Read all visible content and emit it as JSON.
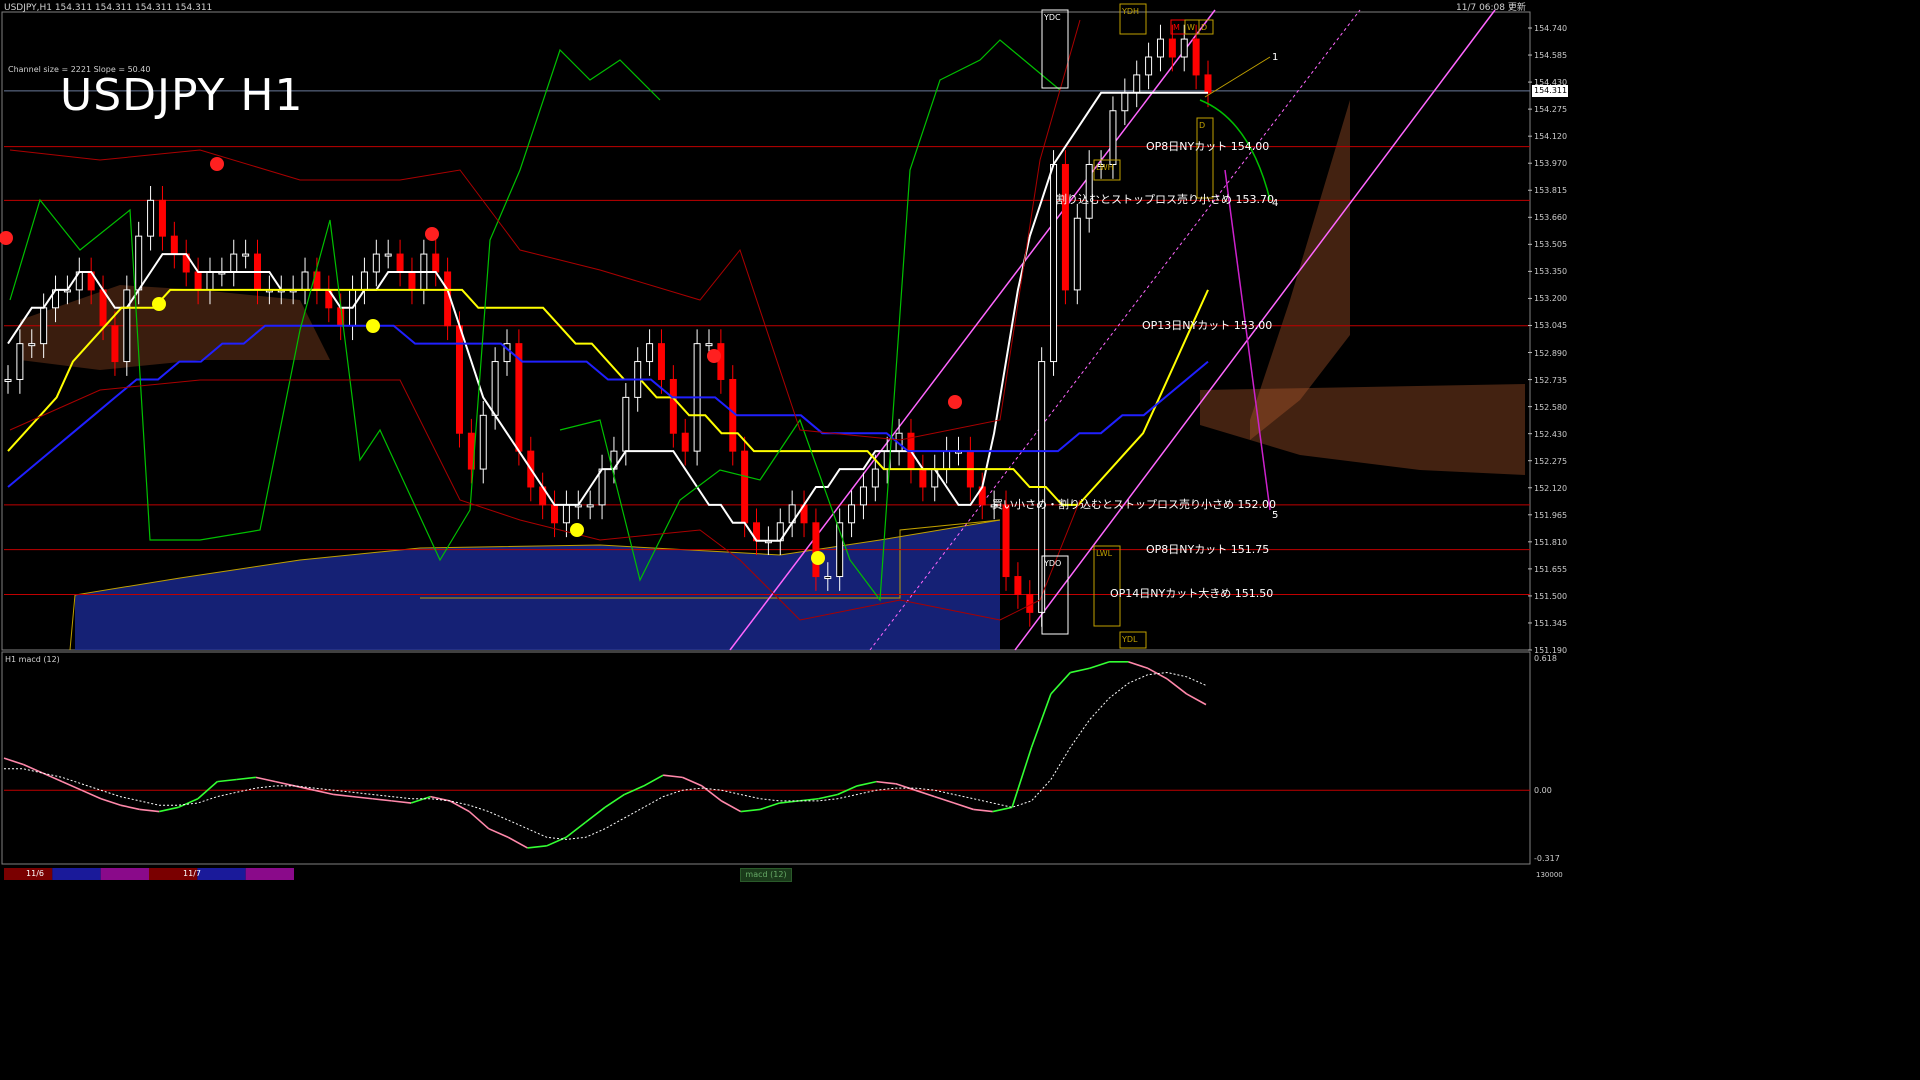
{
  "header": {
    "symbol_info": "USDJPY,H1  154.311 154.311 154.311 154.311",
    "datetime": "11/7 06:08 更新",
    "channel_info": "Channel size = 2221 Slope = 50.40",
    "big_title": "USDJPY H1"
  },
  "chart_data": [
    {
      "type": "line",
      "title": "USDJPY H1",
      "ylim": [
        151.19,
        154.74
      ],
      "yticks": [
        "154.740",
        "154.585",
        "154.430",
        "154.275",
        "154.120",
        "153.970",
        "153.815",
        "153.660",
        "153.505",
        "153.350",
        "153.200",
        "153.045",
        "152.890",
        "152.735",
        "152.580",
        "152.430",
        "152.275",
        "152.120",
        "151.965",
        "151.810",
        "151.655",
        "151.500",
        "151.345",
        "151.190"
      ],
      "current_price": "154.311",
      "price_levels": [
        {
          "price": 154.0,
          "label": "OP8日NYカット 154.00"
        },
        {
          "price": 153.7,
          "label": "割り込むとストップロス売り小さめ 153.70"
        },
        {
          "price": 153.0,
          "label": "OP13日NYカット 153.00"
        },
        {
          "price": 152.0,
          "label": "買い小さめ・割り込むとストップロス売り小さめ 152.00"
        },
        {
          "price": 151.75,
          "label": "OP8日NYカット 151.75"
        },
        {
          "price": 151.5,
          "label": "OP14日NYカット大きめ 151.50"
        }
      ],
      "annotations": [
        "YDC",
        "YDO",
        "YDH",
        "YDL",
        "LWH",
        "LWL",
        "D",
        "W",
        "M",
        "1",
        "4",
        "5"
      ],
      "series": [
        {
          "name": "close",
          "values": [
            152.7,
            152.9,
            152.9,
            153.1,
            153.2,
            153.2,
            153.3,
            153.2,
            153.0,
            152.8,
            153.2,
            153.5,
            153.7,
            153.5,
            153.4,
            153.3,
            153.2,
            153.3,
            153.3,
            153.4,
            153.4,
            153.2,
            153.2,
            153.2,
            153.2,
            153.3,
            153.2,
            153.1,
            153.0,
            153.2,
            153.3,
            153.4,
            153.4,
            153.3,
            153.2,
            153.4,
            153.3,
            153.0,
            152.4,
            152.2,
            152.5,
            152.8,
            152.9,
            152.3,
            152.1,
            152.0,
            151.9,
            152.0,
            152.0,
            152.0,
            152.2,
            152.3,
            152.6,
            152.8,
            152.9,
            152.7,
            152.4,
            152.3,
            152.9,
            152.9,
            152.7,
            152.3,
            151.9,
            151.8,
            151.8,
            151.9,
            152.0,
            151.9,
            151.6,
            151.6,
            151.9,
            152.0,
            152.1,
            152.2,
            152.3,
            152.4,
            152.2,
            152.1,
            152.2,
            152.3,
            152.3,
            152.1,
            152.0,
            152.0,
            151.6,
            151.5,
            151.4,
            152.8,
            153.9,
            153.2,
            153.6,
            153.9,
            153.9,
            154.2,
            154.3,
            154.4,
            154.5,
            154.6,
            154.5,
            154.6,
            154.4,
            154.3
          ]
        },
        {
          "name": "ma-short",
          "values": [
            152.9,
            153.0,
            153.1,
            153.1,
            153.2,
            153.2,
            153.3,
            153.3,
            153.2,
            153.1,
            153.1,
            153.2,
            153.3,
            153.4,
            153.4,
            153.4,
            153.3,
            153.3,
            153.3,
            153.3,
            153.3,
            153.3,
            153.3,
            153.2,
            153.2,
            153.2,
            153.2,
            153.2,
            153.1,
            153.1,
            153.2,
            153.2,
            153.3,
            153.3,
            153.3,
            153.3,
            153.3,
            153.2,
            153.0,
            152.8,
            152.6,
            152.5,
            152.4,
            152.3,
            152.2,
            152.1,
            152.0,
            152.0,
            152.0,
            152.1,
            152.2,
            152.2,
            152.3,
            152.3,
            152.3,
            152.3,
            152.3,
            152.2,
            152.1,
            152.0,
            152.0,
            151.9,
            151.9,
            151.8,
            151.8,
            151.8,
            151.9,
            152.0,
            152.1,
            152.1,
            152.2,
            152.2,
            152.2,
            152.3,
            152.3,
            152.3,
            152.3,
            152.2,
            152.2,
            152.1,
            152.0,
            152.0,
            152.1,
            152.4,
            152.8,
            153.2,
            153.5,
            153.7,
            153.9,
            154.0,
            154.1,
            154.2,
            154.3,
            154.3,
            154.3,
            154.3,
            154.3,
            154.3,
            154.3,
            154.3,
            154.3,
            154.3
          ]
        },
        {
          "name": "ma-mid",
          "values": [
            152.3,
            152.4,
            152.5,
            152.6,
            152.8,
            152.9,
            153.0,
            153.1,
            153.1,
            153.1,
            153.2,
            153.2,
            153.2,
            153.2,
            153.2,
            153.2,
            153.2,
            153.2,
            153.2,
            153.2,
            153.2,
            153.2,
            153.2,
            153.2,
            153.2,
            153.2,
            153.2,
            153.2,
            153.2,
            153.1,
            153.1,
            153.1,
            153.1,
            153.1,
            153.0,
            152.9,
            152.9,
            152.8,
            152.7,
            152.7,
            152.6,
            152.6,
            152.5,
            152.5,
            152.4,
            152.4,
            152.3,
            152.3,
            152.3,
            152.3,
            152.3,
            152.3,
            152.3,
            152.3,
            152.2,
            152.2,
            152.2,
            152.2,
            152.2,
            152.2,
            152.2,
            152.2,
            152.2,
            152.1,
            152.1,
            152.0,
            152.0,
            152.1,
            152.2,
            152.3,
            152.4,
            152.6,
            152.8,
            153.0,
            153.2
          ]
        },
        {
          "name": "ma-long",
          "values": [
            152.1,
            152.2,
            152.3,
            152.4,
            152.5,
            152.6,
            152.7,
            152.7,
            152.8,
            152.8,
            152.9,
            152.9,
            153.0,
            153.0,
            153.0,
            153.0,
            153.0,
            153.0,
            153.0,
            152.9,
            152.9,
            152.9,
            152.9,
            152.9,
            152.8,
            152.8,
            152.8,
            152.8,
            152.7,
            152.7,
            152.7,
            152.6,
            152.6,
            152.6,
            152.5,
            152.5,
            152.5,
            152.5,
            152.4,
            152.4,
            152.4,
            152.4,
            152.3,
            152.3,
            152.3,
            152.3,
            152.3,
            152.3,
            152.3,
            152.3,
            152.4,
            152.4,
            152.5,
            152.5,
            152.6,
            152.7,
            152.8
          ]
        }
      ]
    },
    {
      "type": "line",
      "title": "H1  macd (12)",
      "ylim": [
        -0.317,
        0.618
      ],
      "yticks": [
        "0.618",
        "0.00",
        "-0.317"
      ],
      "series": [
        {
          "name": "macd",
          "values": [
            0.15,
            0.12,
            0.08,
            0.04,
            0.0,
            -0.04,
            -0.07,
            -0.09,
            -0.1,
            -0.08,
            -0.04,
            0.04,
            0.05,
            0.06,
            0.04,
            0.02,
            0.0,
            -0.02,
            -0.03,
            -0.04,
            -0.05,
            -0.06,
            -0.03,
            -0.05,
            -0.1,
            -0.18,
            -0.22,
            -0.27,
            -0.26,
            -0.22,
            -0.15,
            -0.08,
            -0.02,
            0.02,
            0.07,
            0.06,
            0.02,
            -0.05,
            -0.1,
            -0.09,
            -0.06,
            -0.05,
            -0.04,
            -0.02,
            0.02,
            0.04,
            0.03,
            0.0,
            -0.03,
            -0.06,
            -0.09,
            -0.1,
            -0.08,
            0.2,
            0.45,
            0.55,
            0.57,
            0.6,
            0.6,
            0.57,
            0.52,
            0.45,
            0.4
          ]
        },
        {
          "name": "signal",
          "values": [
            0.1,
            0.1,
            0.08,
            0.06,
            0.03,
            0.0,
            -0.03,
            -0.05,
            -0.07,
            -0.07,
            -0.06,
            -0.03,
            -0.01,
            0.01,
            0.02,
            0.02,
            0.01,
            0.0,
            -0.01,
            -0.02,
            -0.03,
            -0.04,
            -0.04,
            -0.05,
            -0.07,
            -0.1,
            -0.14,
            -0.18,
            -0.22,
            -0.23,
            -0.22,
            -0.18,
            -0.13,
            -0.08,
            -0.03,
            0.0,
            0.01,
            0.0,
            -0.02,
            -0.04,
            -0.05,
            -0.05,
            -0.05,
            -0.04,
            -0.02,
            0.0,
            0.01,
            0.01,
            0.0,
            -0.02,
            -0.04,
            -0.06,
            -0.08,
            -0.05,
            0.05,
            0.2,
            0.33,
            0.43,
            0.5,
            0.54,
            0.55,
            0.53,
            0.49
          ]
        }
      ]
    }
  ],
  "time_axis": {
    "labels": [
      "11/6",
      "11/7"
    ],
    "segment_colors": [
      "#7a0000",
      "#1a1a9a",
      "#8a0a8a",
      "#7a0000",
      "#1a1a9a",
      "#8a0a8a"
    ],
    "bottom_right": "130000",
    "bottom_tab": "macd (12)"
  },
  "colors": {
    "background": "#000000",
    "bull_candle": "#ffffff",
    "bear_candle": "#ff0000",
    "ma_short": "#ffffff",
    "ma_mid": "#ffff00",
    "ma_long": "#2020ff",
    "chikou": "#00c000",
    "kumo_blue": "#1c2c9c",
    "kumo_orange": "#c06030",
    "level_line": "#c00000",
    "channel": "#ff66ff",
    "macd": "#33ff33",
    "macd_neg": "#ff88aa",
    "signal": "#ffffff"
  }
}
